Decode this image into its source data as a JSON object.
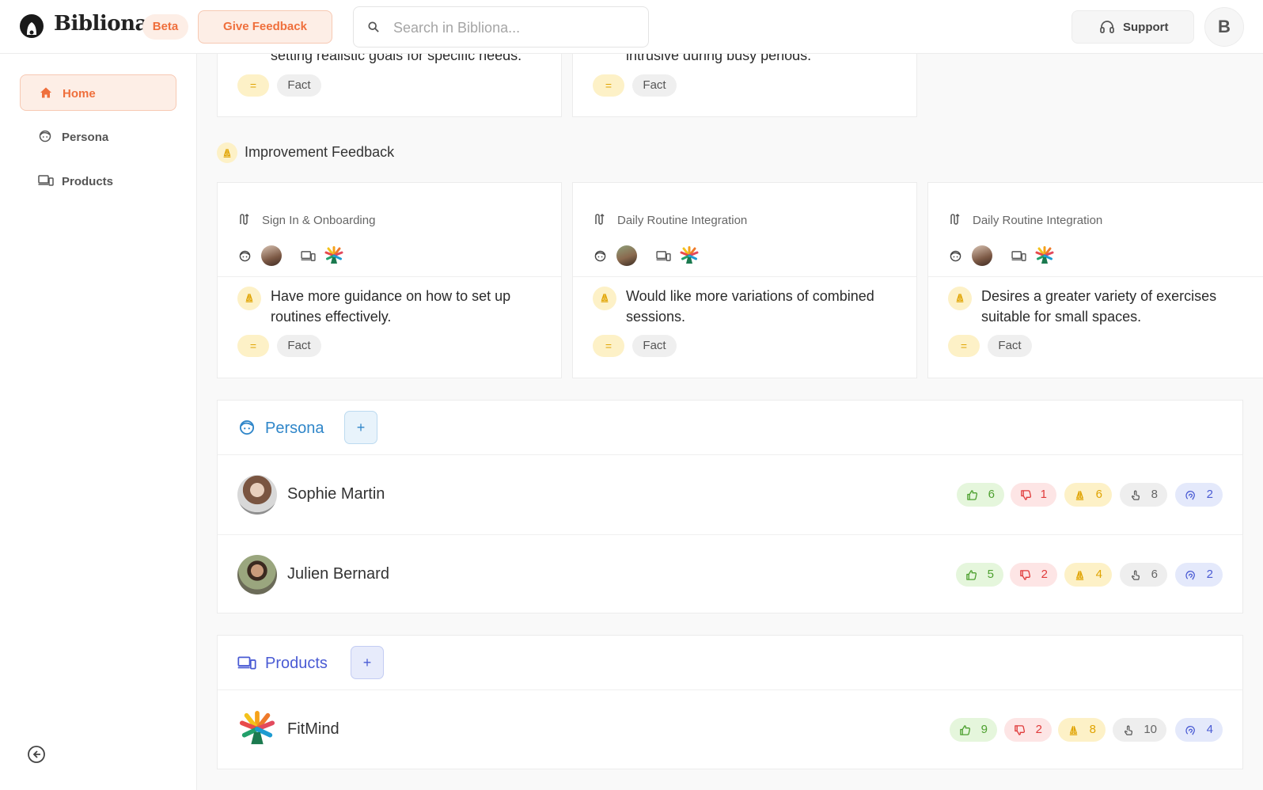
{
  "header": {
    "app_name": "Bibliona",
    "beta_label": "Beta",
    "feedback_label": "Give Feedback",
    "search_placeholder": "Search in Bibliona...",
    "support_label": "Support",
    "user_initial": "B"
  },
  "sidebar": {
    "items": [
      {
        "label": "Home",
        "icon": "home-icon",
        "active": true
      },
      {
        "label": "Persona",
        "icon": "persona-face-icon",
        "active": false
      },
      {
        "label": "Products",
        "icon": "devices-icon",
        "active": false
      }
    ]
  },
  "top_cards": [
    {
      "text": "setting realistic goals for specific needs.",
      "equals": "=",
      "tag": "Fact"
    },
    {
      "text": "intrusive during busy periods.",
      "equals": "=",
      "tag": "Fact"
    }
  ],
  "improvement": {
    "section_title": "Improvement Feedback",
    "cards": [
      {
        "category": "Sign In & Onboarding",
        "text": "Have more guidance on how to set up routines effectively.",
        "equals": "=",
        "tag": "Fact"
      },
      {
        "category": "Daily Routine Integration",
        "text": "Would like more variations of combined sessions.",
        "equals": "=",
        "tag": "Fact"
      },
      {
        "category": "Daily Routine Integration",
        "text": "Desires a greater variety of exercises suitable for small spaces.",
        "equals": "=",
        "tag": "Fact"
      }
    ]
  },
  "persona_panel": {
    "title": "Persona",
    "add_label": "+",
    "rows": [
      {
        "name": "Sophie Martin",
        "likes": "6",
        "dislikes": "1",
        "improvements": "6",
        "touches": "8",
        "ideas": "2"
      },
      {
        "name": "Julien Bernard",
        "likes": "5",
        "dislikes": "2",
        "improvements": "4",
        "touches": "6",
        "ideas": "2"
      }
    ]
  },
  "products_panel": {
    "title": "Products",
    "add_label": "+",
    "rows": [
      {
        "name": "FitMind",
        "likes": "9",
        "dislikes": "2",
        "improvements": "8",
        "touches": "10",
        "ideas": "4"
      }
    ]
  },
  "colors": {
    "accent": "#ef6f3c",
    "persona_blue": "#2f86c9",
    "products_indigo": "#4a5bd4"
  }
}
